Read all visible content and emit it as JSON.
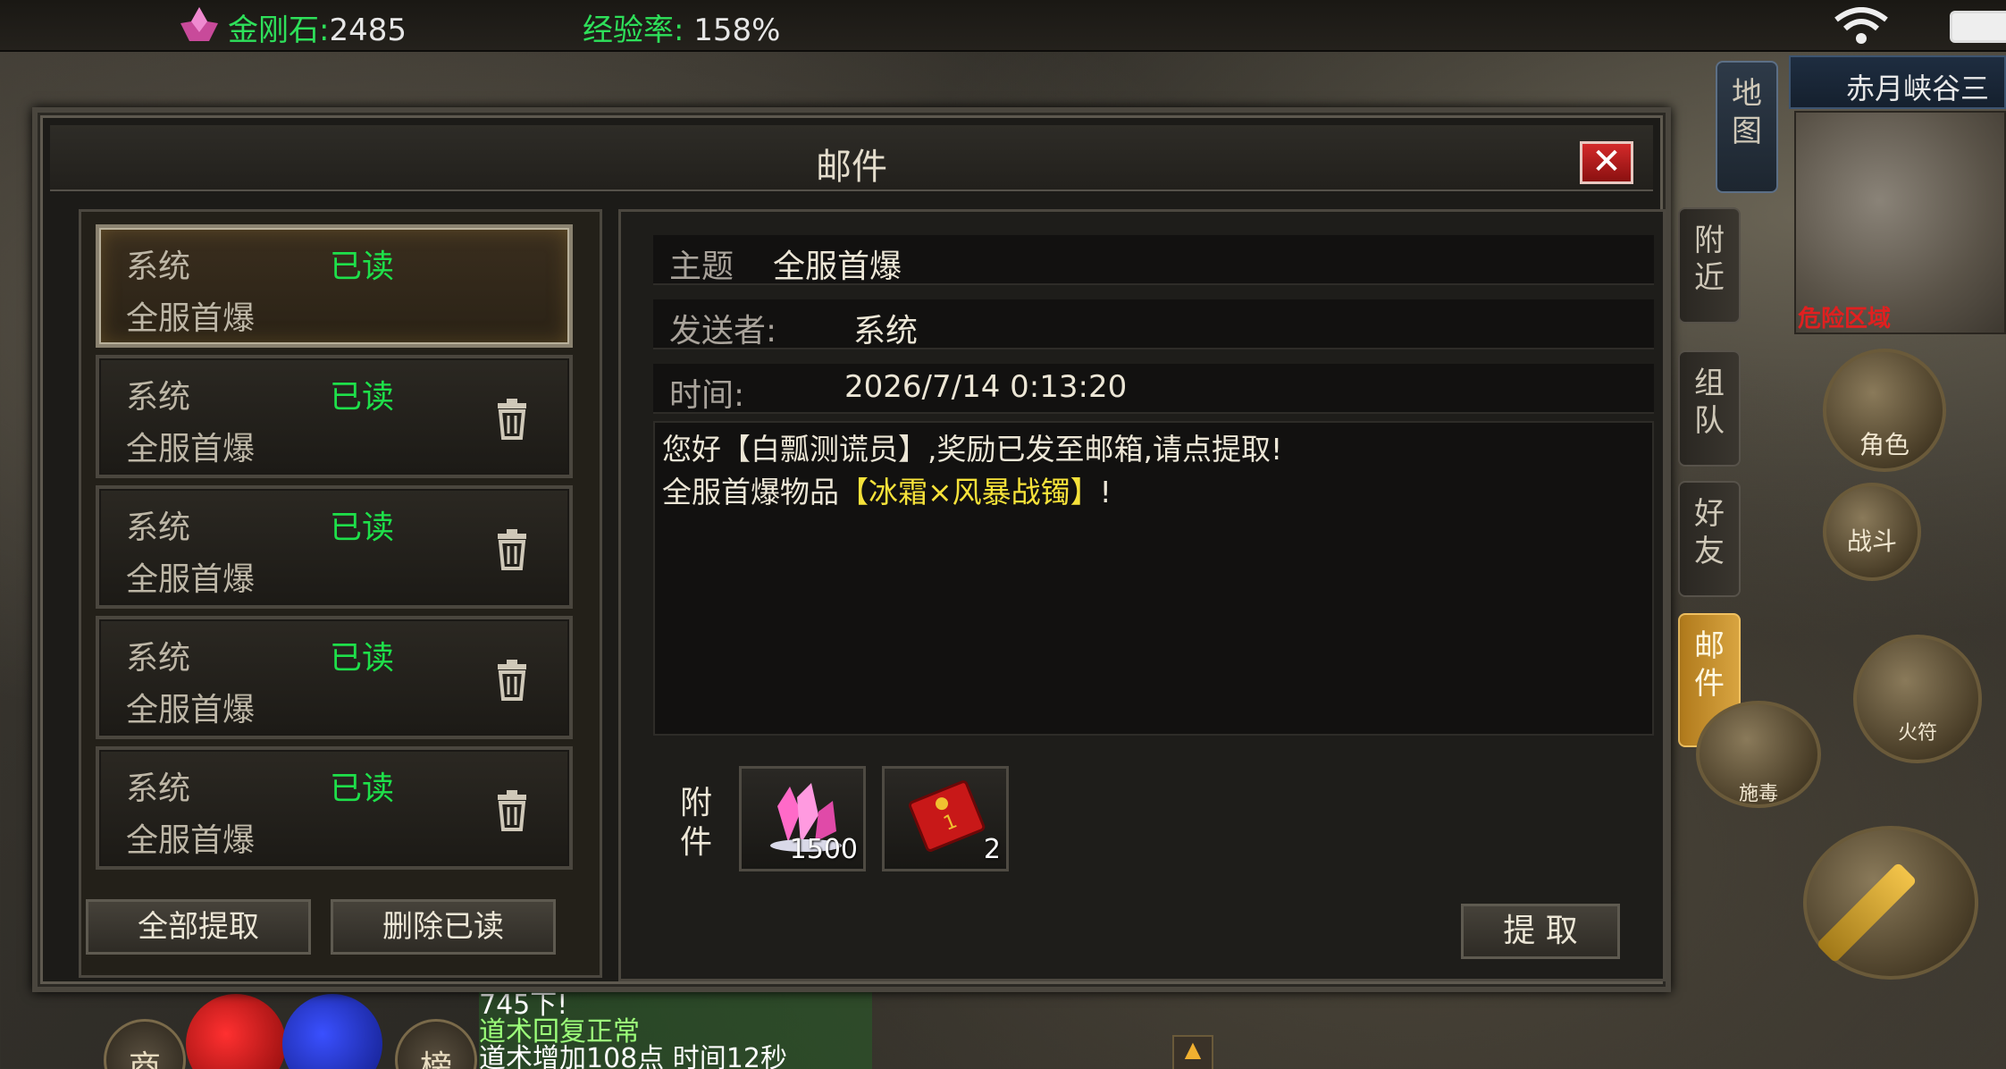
{
  "topbar": {
    "diamond_label": "金刚石:",
    "diamond_value": "2485",
    "exp_label": "经验率:",
    "exp_value": "158%"
  },
  "map": {
    "title": "赤月峡谷三",
    "danger_text": "危险区域"
  },
  "side_tabs": {
    "map": "地图",
    "nearby": "附近",
    "team": "组队",
    "friends": "好友",
    "mail": "邮件"
  },
  "hud": {
    "role": "角色",
    "fight": "战斗",
    "fire": "火符",
    "skill1": "施毒",
    "shop": "商",
    "rank": "榜",
    "up_arrow": "▲"
  },
  "chat": [
    "745下!",
    "道术回复正常",
    "道术增加108点 时间12秒"
  ],
  "mail": {
    "title": "邮件",
    "close": "✕",
    "items": [
      {
        "sender": "系统",
        "status": "已读",
        "subject": "全服首爆"
      },
      {
        "sender": "系统",
        "status": "已读",
        "subject": "全服首爆"
      },
      {
        "sender": "系统",
        "status": "已读",
        "subject": "全服首爆"
      },
      {
        "sender": "系统",
        "status": "已读",
        "subject": "全服首爆"
      },
      {
        "sender": "系统",
        "status": "已读",
        "subject": "全服首爆"
      }
    ],
    "claim_all": "全部提取",
    "delete_read": "删除已读",
    "detail": {
      "subject_label": "主题",
      "subject_value": "全服首爆",
      "sender_label": "发送者:",
      "sender_value": "系统",
      "time_label": "时间:",
      "time_value": "2026/7/14 0:13:20",
      "body_line1": "您好【白瓢测谎员】,奖励已发至邮箱,请点提取!",
      "body_line2_prefix": "全服首爆物品",
      "body_line2_item": "【冰霜×风暴战镯】",
      "body_line2_suffix": "!",
      "attach_label": "附件",
      "attachments": [
        {
          "icon": "pink-crystal-icon",
          "qty": "1500"
        },
        {
          "icon": "red-envelope-icon",
          "qty": "2"
        }
      ],
      "claim": "提 取"
    }
  },
  "colors": {
    "green_status": "#1ee04a",
    "highlight_yellow": "#f6e23a",
    "close_red": "#d42a2a"
  }
}
